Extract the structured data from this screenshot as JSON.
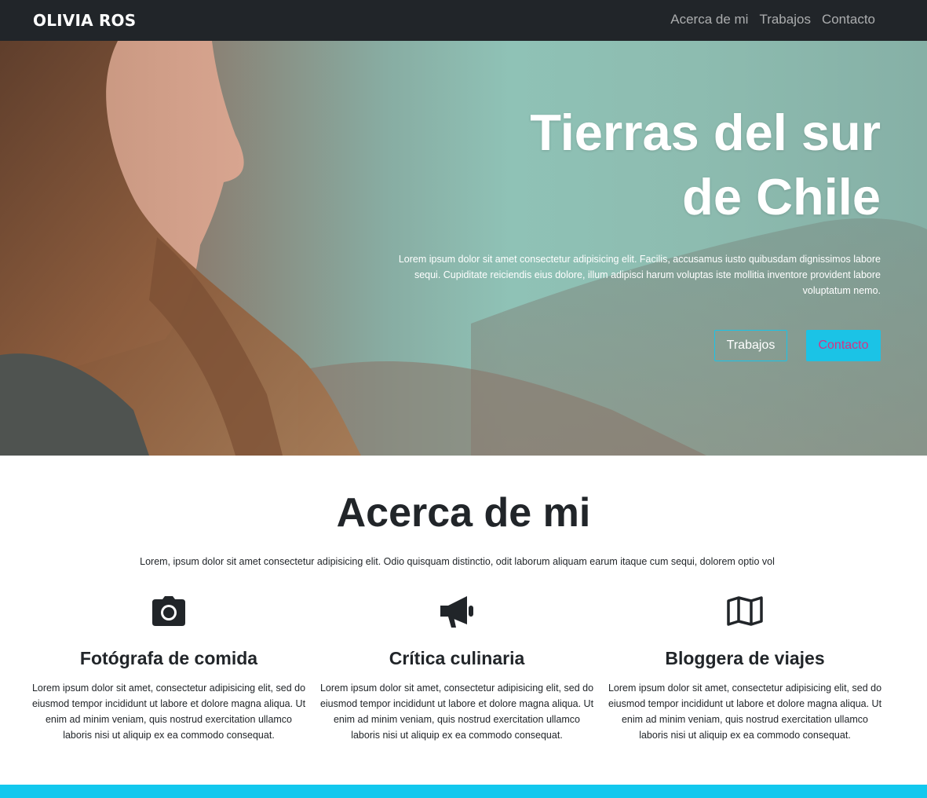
{
  "navbar": {
    "brand": "OLIVIA ROS",
    "links": [
      "Acerca de mi",
      "Trabajos",
      "Contacto"
    ]
  },
  "hero": {
    "title_line1": "Tierras del sur",
    "title_line2": "de Chile",
    "text": "Lorem ipsum dolor sit amet consectetur adipisicing elit. Facilis, accusamus iusto quibusdam dignissimos labore sequi. Cupiditate reiciendis eius dolore, illum adipisci harum voluptas iste mollitia inventore provident labore voluptatum nemo.",
    "buttons": {
      "primary": "Trabajos",
      "secondary": "Contacto"
    }
  },
  "about": {
    "title": "Acerca de mi",
    "lead": "Lorem, ipsum dolor sit amet consectetur adipisicing elit. Odio quisquam distinctio, odit laborum aliquam earum itaque cum sequi, dolorem optio vol",
    "features": [
      {
        "icon": "camera-icon",
        "title": "Fotógrafa de comida",
        "text": "Lorem ipsum dolor sit amet, consectetur adipisicing elit, sed do eiusmod tempor incididunt ut labore et dolore magna aliqua. Ut enim ad minim veniam, quis nostrud exercitation ullamco laboris nisi ut aliquip ex ea commodo consequat."
      },
      {
        "icon": "megaphone-icon",
        "title": "Crítica culinaria",
        "text": "Lorem ipsum dolor sit amet, consectetur adipisicing elit, sed do eiusmod tempor incididunt ut labore et dolore magna aliqua. Ut enim ad minim veniam, quis nostrud exercitation ullamco laboris nisi ut aliquip ex ea commodo consequat."
      },
      {
        "icon": "map-icon",
        "title": "Bloggera de viajes",
        "text": "Lorem ipsum dolor sit amet, consectetur adipisicing elit, sed do eiusmod tempor incididunt ut labore et dolore magna aliqua. Ut enim ad minim veniam, quis nostrud exercitation ullamco laboris nisi ut aliquip ex ea commodo consequat."
      }
    ]
  },
  "colors": {
    "navbar_bg": "#212529",
    "accent": "#1bc3e6",
    "secondary_button_text": "#d63384"
  }
}
